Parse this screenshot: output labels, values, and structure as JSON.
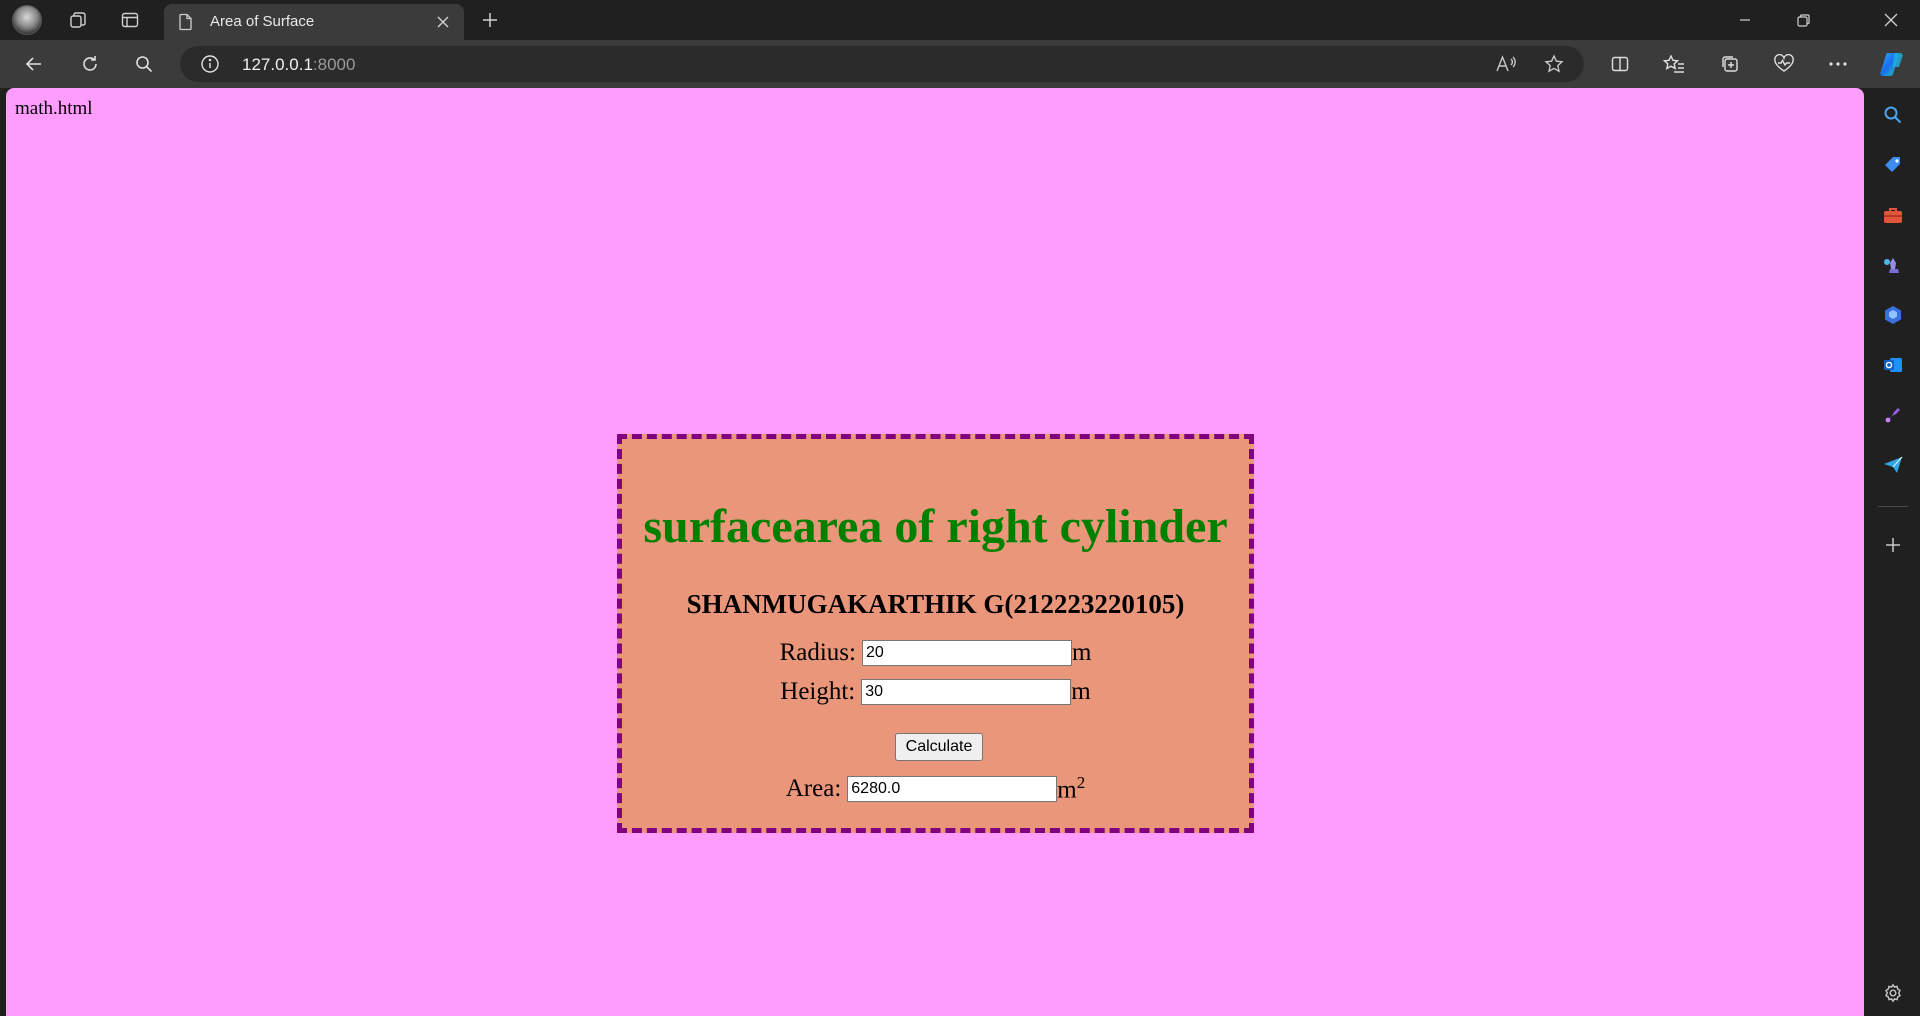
{
  "browser": {
    "tab_title": "Area of Surface",
    "url_host": "127.0.0.1",
    "url_port": ":8000"
  },
  "page": {
    "file_label": "math.html",
    "heading": "surfacearea of right cylinder",
    "author": "SHANMUGAKARTHIK G(212223220105)",
    "radius_label": "Radius:",
    "radius_value": "20",
    "radius_unit": "m",
    "height_label": "Height:",
    "height_value": "30",
    "height_unit": "m",
    "calculate_label": "Calculate",
    "area_label": "Area:",
    "area_value": "6280.0",
    "area_unit": "m",
    "area_unit_exp": "2"
  },
  "colors": {
    "page_bg": "#ff9dff",
    "card_bg": "#e9967a",
    "card_border": "#800080",
    "heading": "#008000"
  }
}
